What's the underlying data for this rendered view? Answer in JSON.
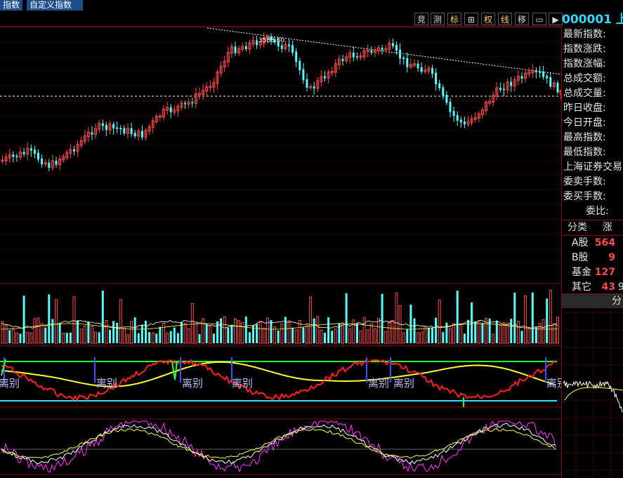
{
  "tabs": {
    "tab1": "指数",
    "tab2": "自定义指数"
  },
  "toolbar": {
    "b1": "竞",
    "b2": "测",
    "b3": "标",
    "b4": "⊞",
    "b5": "权",
    "b6": "线",
    "b7": "移"
  },
  "index_code": "000001 上",
  "info_labels": [
    "最新指数:",
    "指数涨跌:",
    "指数涨幅:",
    "总成交额:",
    "总成交量:",
    "昨日收盘:",
    "今日开盘:",
    "最高指数:",
    "最低指数:",
    "上海证券交易",
    "委卖手数:",
    "委买手数:",
    "委比:"
  ],
  "category_header": {
    "col1": "分类",
    "col2": "涨"
  },
  "categories": [
    {
      "name": "A股",
      "up": "564"
    },
    {
      "name": "B股",
      "up": "9"
    },
    {
      "name": "基金",
      "up": "127"
    },
    {
      "name": "其它",
      "up": "43"
    }
  ],
  "other_extra": "9",
  "fen_button": "分",
  "peak_label": "3588.60",
  "divergence_label": "离别",
  "colors": {
    "up": "#ff4a4a",
    "down": "#54ffff",
    "grid": "#7a1010",
    "yellow": "#ffff33",
    "green": "#33ff33",
    "magenta": "#ff33ff",
    "blue": "#3355ff"
  }
}
